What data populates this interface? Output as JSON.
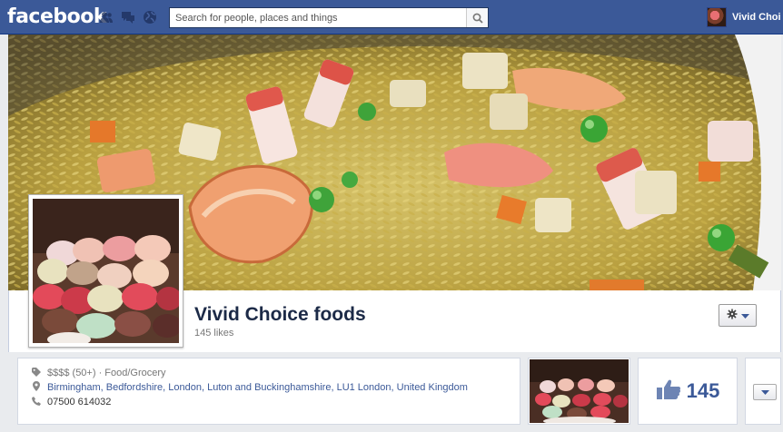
{
  "topbar": {
    "logo": "facebook",
    "search_placeholder": "Search for people, places and things",
    "user_name": "Vivid Choi",
    "icons": [
      "friend-requests-icon",
      "messages-icon",
      "notifications-globe-icon",
      "search-icon"
    ]
  },
  "page": {
    "name": "Vivid Choice foods",
    "likes_text": "145 likes"
  },
  "about": {
    "category_price": "$$$$ (50+)",
    "category_sep": " · ",
    "category": "Food/Grocery",
    "address": "Birmingham, Bedfordshire, London, Luton and Buckinghamshire, LU1 London, United Kingdom",
    "phone": "07500 614032"
  },
  "likes_box": {
    "count": "145"
  },
  "colors": {
    "brand_blue": "#3b5998",
    "page_bg": "#e9ebee"
  }
}
